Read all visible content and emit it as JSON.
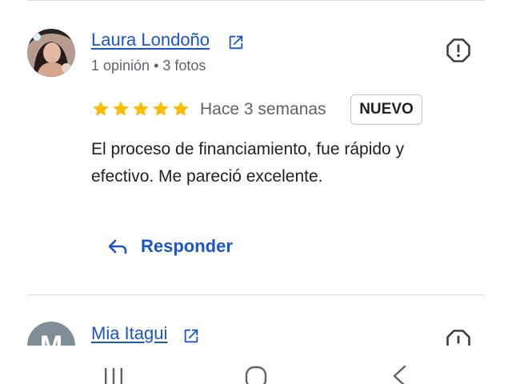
{
  "reviews": [
    {
      "name": "Laura Londoño",
      "meta": "1 opinión • 3 fotos",
      "rating": 5,
      "max_rating": 5,
      "date": "Hace 3 semanas",
      "badge": "NUEVO",
      "text": "El proceso de financiamiento, fue rápido y efectivo. Me pareció excelente.",
      "reply_label": "Responder"
    },
    {
      "name": "Mia Itagui",
      "avatar_initial": "M"
    }
  ],
  "colors": {
    "link": "#1a56c9",
    "star": "#fbbc04",
    "muted_text": "#5f6368",
    "divider": "#dadce0"
  },
  "icons": {
    "external_link": "open-in-new-icon",
    "report": "report-icon",
    "reply": "reply-arrow-icon",
    "star": "star-icon",
    "nav_recents": "recents-icon",
    "nav_home": "home-icon",
    "nav_back": "back-icon"
  }
}
